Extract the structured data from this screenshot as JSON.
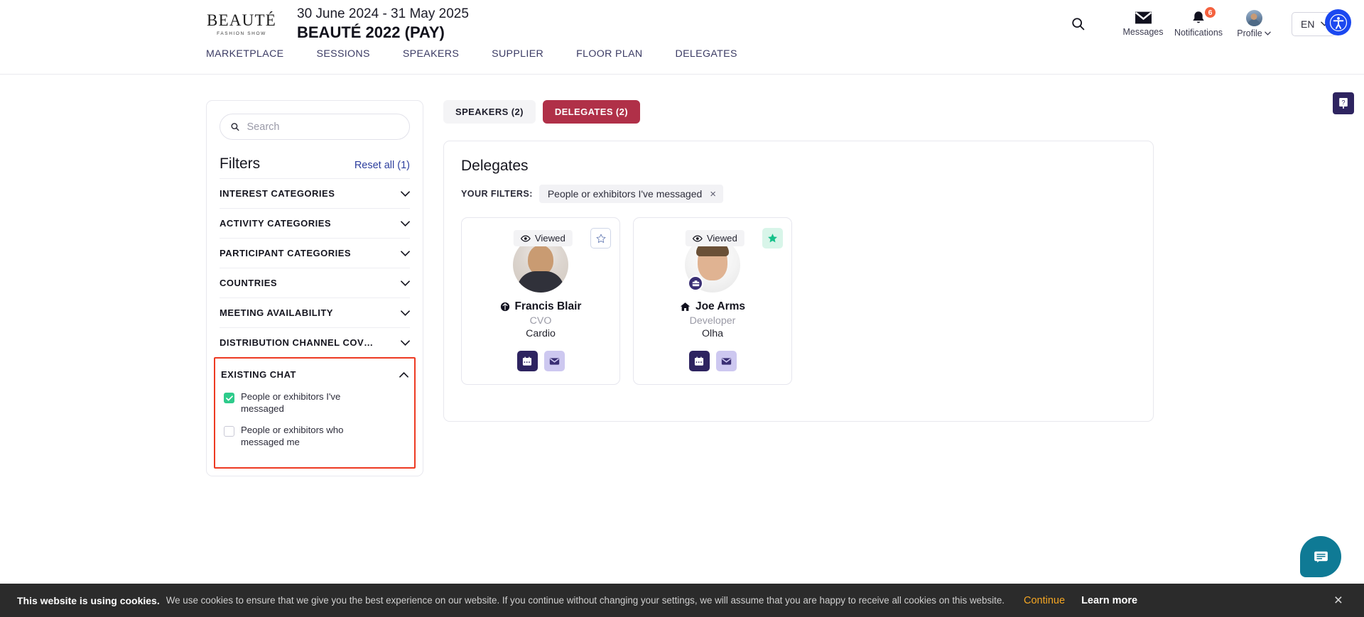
{
  "header": {
    "logo_main": "BEAUTÉ",
    "logo_sub": "FASHION SHOW",
    "event_dates": "30 June 2024 - 31 May 2025",
    "event_title": "BEAUTÉ 2022 (PAY)",
    "search_icon": "search-icon",
    "messages_label": "Messages",
    "notifications_label": "Notifications",
    "notifications_count": "6",
    "profile_label": "Profile",
    "language": "EN",
    "accessibility_icon": "accessibility-icon",
    "accent_badge_color": "#f4613e",
    "accessibility_color": "#1b48f0"
  },
  "nav": {
    "items": [
      {
        "label": "MARKETPLACE"
      },
      {
        "label": "SESSIONS"
      },
      {
        "label": "SPEAKERS"
      },
      {
        "label": "SUPPLIER"
      },
      {
        "label": "FLOOR PLAN"
      },
      {
        "label": "DELEGATES"
      }
    ]
  },
  "sidebar": {
    "search_placeholder": "Search",
    "search_value": "",
    "filters_title": "Filters",
    "reset_all": "Reset all (1)",
    "groups": [
      {
        "label": "INTEREST CATEGORIES",
        "expanded": false
      },
      {
        "label": "ACTIVITY CATEGORIES",
        "expanded": false
      },
      {
        "label": "PARTICIPANT CATEGORIES",
        "expanded": false
      },
      {
        "label": "COUNTRIES",
        "expanded": false
      },
      {
        "label": "MEETING AVAILABILITY",
        "expanded": false
      },
      {
        "label": "DISTRIBUTION CHANNEL COVER...",
        "expanded": false
      }
    ],
    "existing_chat": {
      "label": "EXISTING CHAT",
      "highlight_color": "#ed3a22",
      "options": [
        {
          "label": "People or exhibitors I've messaged",
          "checked": true
        },
        {
          "label": "People or exhibitors who messaged me",
          "checked": false
        }
      ]
    }
  },
  "main": {
    "tabs": [
      {
        "label": "SPEAKERS (2)",
        "active": false
      },
      {
        "label": "DELEGATES (2)",
        "active": true
      }
    ],
    "active_tab_color": "#b03048",
    "panel_title": "Delegates",
    "your_filters_label": "YOUR FILTERS:",
    "filter_chips": [
      {
        "label": "People or exhibitors I've messaged",
        "remove": "×"
      }
    ],
    "cards": [
      {
        "viewed_label": "Viewed",
        "viewed_icon": "eye-icon",
        "corner_icon": "star-outline-icon",
        "corner_state": "outline",
        "status_icon": "globe-icon",
        "name": "Francis Blair",
        "role": "CVO",
        "company": "Cardio",
        "has_ribbon": false,
        "actions": [
          {
            "icon": "calendar-icon",
            "style": "dark"
          },
          {
            "icon": "envelope-icon",
            "style": "light"
          }
        ]
      },
      {
        "viewed_label": "Viewed",
        "viewed_icon": "eye-icon",
        "corner_icon": "star-filled-icon",
        "corner_state": "filled",
        "status_icon": "home-icon",
        "name": "Joe Arms",
        "role": "Developer",
        "company": "Olha",
        "has_ribbon": true,
        "ribbon_icon": "briefcase-icon",
        "actions": [
          {
            "icon": "calendar-icon",
            "style": "dark"
          },
          {
            "icon": "envelope-icon",
            "style": "light"
          }
        ]
      }
    ]
  },
  "floating": {
    "help_label": "?",
    "help_icon": "question-badge-icon",
    "chat_icon": "chat-bubble-icon",
    "chat_color": "#0f7a95"
  },
  "cookie_bar": {
    "strong": "This website is using cookies.",
    "text": "We use cookies to ensure that we give you the best experience on our website. If you continue without changing your settings, we will assume that you are happy to receive all cookies on this website.",
    "continue": "Continue",
    "learn_more": "Learn more",
    "close": "×",
    "continue_color": "#f5a623"
  }
}
